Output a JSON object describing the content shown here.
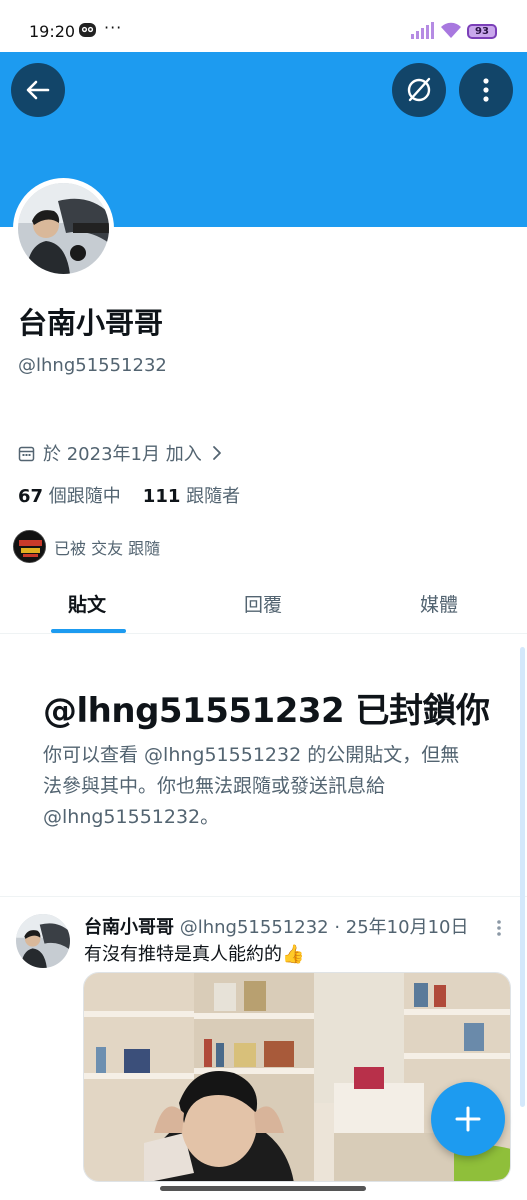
{
  "status_bar": {
    "time": "19:20",
    "dots": "···",
    "battery": "93"
  },
  "header": {
    "back_icon": "arrow-left-icon",
    "grok_icon": "grok-icon",
    "more_icon": "more-vertical-icon",
    "banner_color": "#1d9bf0"
  },
  "profile": {
    "display_name": "台南小哥哥",
    "handle": "@lhng51551232",
    "joined": "於 2023年1月 加入",
    "following_count": "67",
    "following_label": "個跟隨中",
    "followers_count": "111",
    "followers_label": "跟隨者",
    "followed_by": "已被 交友 跟隨"
  },
  "tabs": [
    {
      "label": "貼文",
      "active": true
    },
    {
      "label": "回覆",
      "active": false
    },
    {
      "label": "媒體",
      "active": false
    }
  ],
  "blocked": {
    "title": "@lhng51551232 已封鎖你",
    "description": "你可以查看 @lhng51551232 的公開貼文，但無法參與其中。你也無法跟隨或發送訊息給 @lhng51551232。"
  },
  "tweet": {
    "name": "台南小哥哥",
    "meta": "@lhng51551232 · 25年10月10日",
    "text": "有沒有推特是真人能約的👍"
  },
  "fab": {
    "icon": "plus-icon"
  },
  "accent_color": "#1d9bf0"
}
